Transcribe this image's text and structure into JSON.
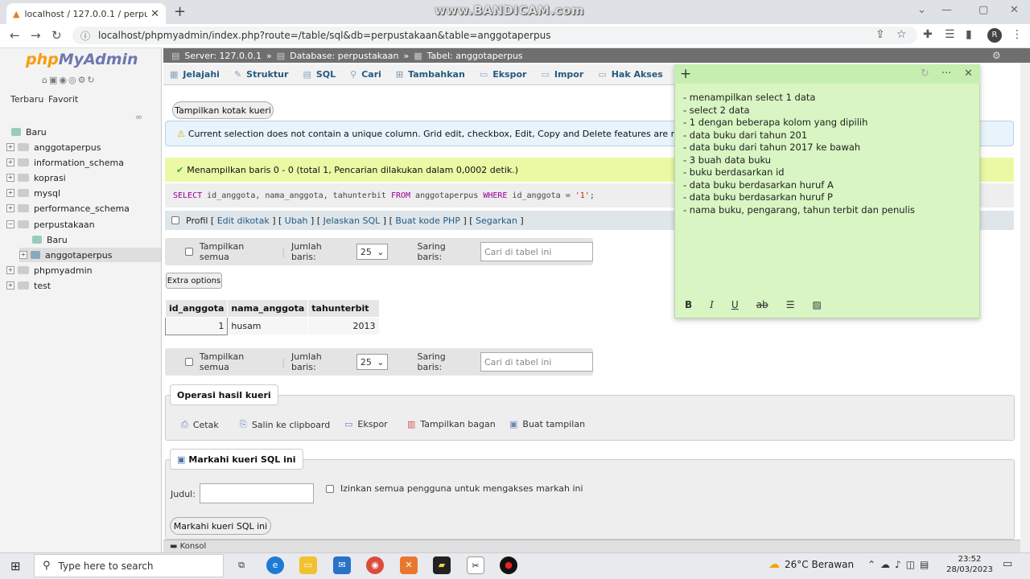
{
  "browser": {
    "tab_title": "localhost / 127.0.0.1 / perpustaka",
    "watermark": "www.BANDICAM.com",
    "url": "localhost/phpmyadmin/index.php?route=/table/sql&db=perpustakaan&table=anggotaperpus",
    "profile_initial": "R"
  },
  "sidebar": {
    "logo_php": "php",
    "logo_myadmin": "MyAdmin",
    "tab_recent": "Terbaru",
    "tab_favorite": "Favorit",
    "tree": [
      {
        "label": "Baru",
        "level": 0
      },
      {
        "label": "anggotaperpus",
        "level": 0
      },
      {
        "label": "information_schema",
        "level": 0
      },
      {
        "label": "koprasi",
        "level": 0
      },
      {
        "label": "mysql",
        "level": 0
      },
      {
        "label": "performance_schema",
        "level": 0
      },
      {
        "label": "perpustakaan",
        "level": 0
      },
      {
        "label": "Baru",
        "level": 1
      },
      {
        "label": "anggotaperpus",
        "level": 1
      },
      {
        "label": "phpmyadmin",
        "level": 0
      },
      {
        "label": "test",
        "level": 0
      }
    ]
  },
  "breadcrumb": {
    "server": "Server: 127.0.0.1",
    "database": "Database: perpustakaan",
    "table": "Tabel: anggotaperpus"
  },
  "menu": [
    "Jelajahi",
    "Struktur",
    "SQL",
    "Cari",
    "Tambahkan",
    "Ekspor",
    "Impor",
    "Hak Akses"
  ],
  "main": {
    "show_query_box": "Tampilkan kotak kueri",
    "warning": "Current selection does not contain a unique column. Grid edit, checkbox, Edit, Copy and Delete features are not available.",
    "success": "Menampilkan baris 0 - 0 (total 1, Pencarian dilakukan dalam 0,0002 detik.)",
    "sql_select": "SELECT",
    "sql_cols": " id_anggota, nama_anggota, tahunterbit ",
    "sql_from": "FROM",
    "sql_table": " anggotaperpus ",
    "sql_where": "WHERE",
    "sql_cond": " id_anggota = ",
    "sql_value": "'1'",
    "sql_end": ";",
    "profile_label": "Profil",
    "profile_links": [
      "Edit dikotak",
      "Ubah",
      "Jelaskan SQL",
      "Buat kode PHP",
      "Segarkan"
    ],
    "show_all": "Tampilkan semua",
    "rows_label": "Jumlah baris:",
    "rows_value": "25",
    "filter_label": "Saring baris:",
    "filter_placeholder": "Cari di tabel ini",
    "extra_options": "Extra options",
    "table": {
      "headers": [
        "id_anggota",
        "nama_anggota",
        "tahunterbit"
      ],
      "rows": [
        [
          "1",
          "husam",
          "2013"
        ]
      ]
    },
    "operations_title": "Operasi hasil kueri",
    "operations": [
      "Cetak",
      "Salin ke clipboard",
      "Ekspor",
      "Tampilkan bagan",
      "Buat tampilan"
    ],
    "bookmark_title": "Markahi kueri SQL ini",
    "bookmark_label": "Judul:",
    "bookmark_share": "Izinkan semua pengguna untuk mengakses markah ini",
    "bookmark_button": "Markahi kueri SQL ini",
    "console": "Konsol"
  },
  "sticky_note": {
    "lines": [
      "- menampilkan select 1 data",
      "- select 2 data",
      "- 1 dengan beberapa kolom yang dipilih",
      "- data buku dari tahun 201",
      "- data buku dari tahun 2017 ke bawah",
      "- 3 buah data buku",
      "- buku berdasarkan id",
      "- data buku berdasarkan huruf A",
      "- data buku berdasarkan huruf P",
      "- nama buku, pengarang, tahun terbit dan penulis"
    ],
    "format": [
      "B",
      "I",
      "U",
      "ab"
    ]
  },
  "taskbar": {
    "search_placeholder": "Type here to search",
    "weather": "26°C  Berawan",
    "time": "23:52",
    "date": "28/03/2023"
  }
}
